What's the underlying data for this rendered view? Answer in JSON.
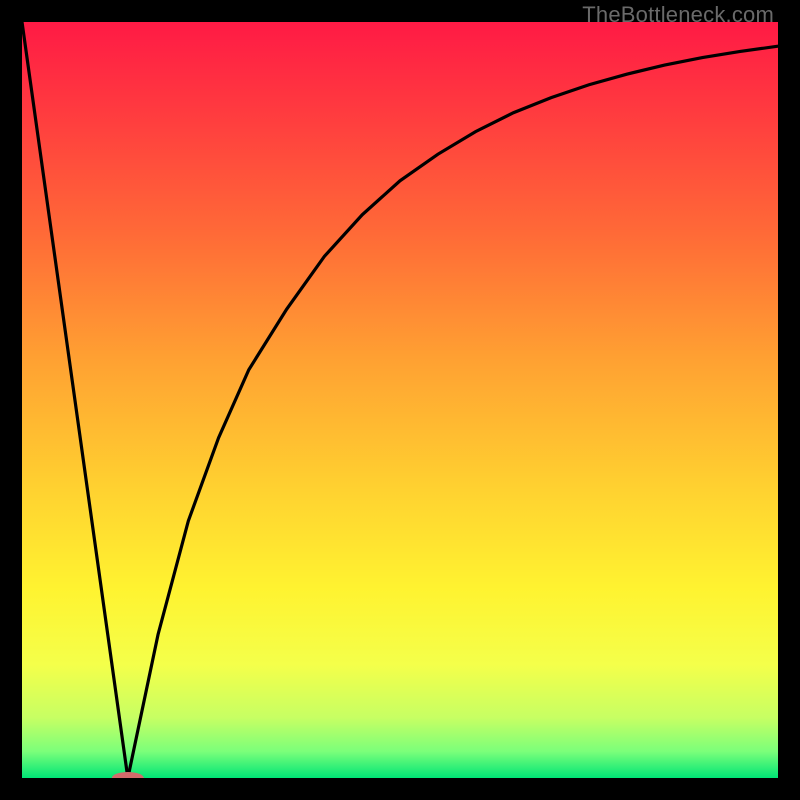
{
  "watermark": "TheBottleneck.com",
  "chart_data": {
    "type": "line",
    "title": "",
    "xlabel": "",
    "ylabel": "",
    "xlim": [
      0,
      100
    ],
    "ylim": [
      0,
      100
    ],
    "grid": false,
    "series": [
      {
        "name": "left-descent",
        "x": [
          0,
          14
        ],
        "values": [
          100,
          0
        ]
      },
      {
        "name": "right-curve",
        "x": [
          14,
          18,
          22,
          26,
          30,
          35,
          40,
          45,
          50,
          55,
          60,
          65,
          70,
          75,
          80,
          85,
          90,
          95,
          100
        ],
        "values": [
          0,
          19,
          34,
          45,
          54,
          62,
          69,
          74.5,
          79,
          82.5,
          85.5,
          88,
          90,
          91.7,
          93.1,
          94.3,
          95.3,
          96.1,
          96.8
        ]
      }
    ],
    "marker": {
      "x": 14,
      "y": 0,
      "color": "#d36a6b",
      "rx": 16,
      "ry": 6
    },
    "gradient_stops": [
      {
        "offset": 0.0,
        "color": "#ff1a45"
      },
      {
        "offset": 0.12,
        "color": "#ff3b3f"
      },
      {
        "offset": 0.28,
        "color": "#ff6a37"
      },
      {
        "offset": 0.45,
        "color": "#ffa232"
      },
      {
        "offset": 0.62,
        "color": "#ffd230"
      },
      {
        "offset": 0.75,
        "color": "#fff330"
      },
      {
        "offset": 0.85,
        "color": "#f4ff4a"
      },
      {
        "offset": 0.92,
        "color": "#c7ff63"
      },
      {
        "offset": 0.965,
        "color": "#7bff7a"
      },
      {
        "offset": 1.0,
        "color": "#00e576"
      }
    ]
  }
}
